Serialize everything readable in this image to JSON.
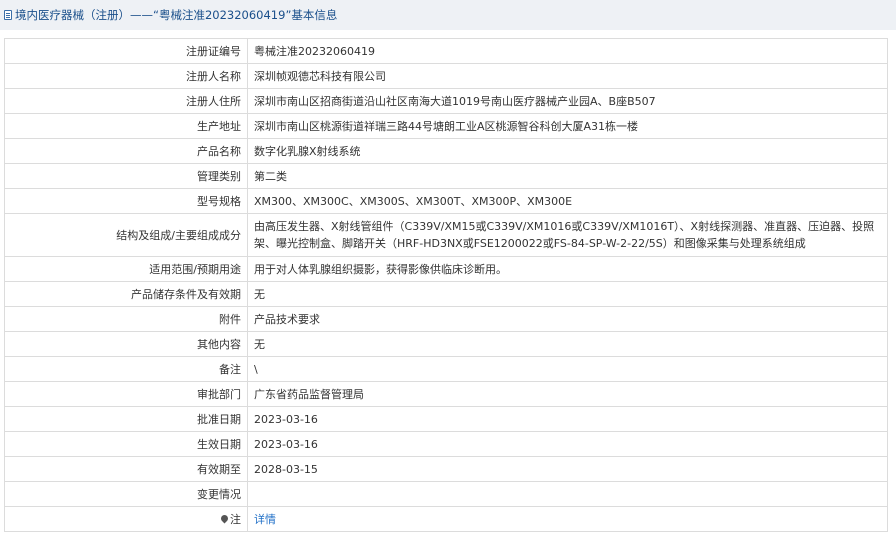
{
  "header": {
    "title": "境内医疗器械（注册）——“粤械注准20232060419”基本信息"
  },
  "rows": [
    {
      "label": "注册证编号",
      "value": "粤械注准20232060419"
    },
    {
      "label": "注册人名称",
      "value": "深圳帧观德芯科技有限公司"
    },
    {
      "label": "注册人住所",
      "value": "深圳市南山区招商街道沿山社区南海大道1019号南山医疗器械产业园A、B座B507"
    },
    {
      "label": "生产地址",
      "value": "深圳市南山区桃源街道祥瑞三路44号塘朗工业A区桃源智谷科创大厦A31栋一楼"
    },
    {
      "label": "产品名称",
      "value": "数字化乳腺X射线系统"
    },
    {
      "label": "管理类别",
      "value": "第二类"
    },
    {
      "label": "型号规格",
      "value": "XM300、XM300C、XM300S、XM300T、XM300P、XM300E"
    },
    {
      "label": "结构及组成/主要组成成分",
      "value": "由高压发生器、X射线管组件（C339V/XM15或C339V/XM1016或C339V/XM1016T）、X射线探测器、准直器、压迫器、投照架、曝光控制盒、脚踏开关（HRF-HD3NX或FSE1200022或FS-84-SP-W-2-22/5S）和图像采集与处理系统组成"
    },
    {
      "label": "适用范围/预期用途",
      "value": "用于对人体乳腺组织摄影，获得影像供临床诊断用。"
    },
    {
      "label": "产品储存条件及有效期",
      "value": "无"
    },
    {
      "label": "附件",
      "value": "产品技术要求"
    },
    {
      "label": "其他内容",
      "value": "无"
    },
    {
      "label": "备注",
      "value": "\\"
    },
    {
      "label": "审批部门",
      "value": "广东省药品监督管理局"
    },
    {
      "label": "批准日期",
      "value": "2023-03-16"
    },
    {
      "label": "生效日期",
      "value": "2023-03-16"
    },
    {
      "label": "有效期至",
      "value": "2028-03-15"
    },
    {
      "label": "变更情况",
      "value": ""
    }
  ],
  "note_row": {
    "label": "注",
    "link_text": "详情",
    "icon": "pin-icon"
  }
}
